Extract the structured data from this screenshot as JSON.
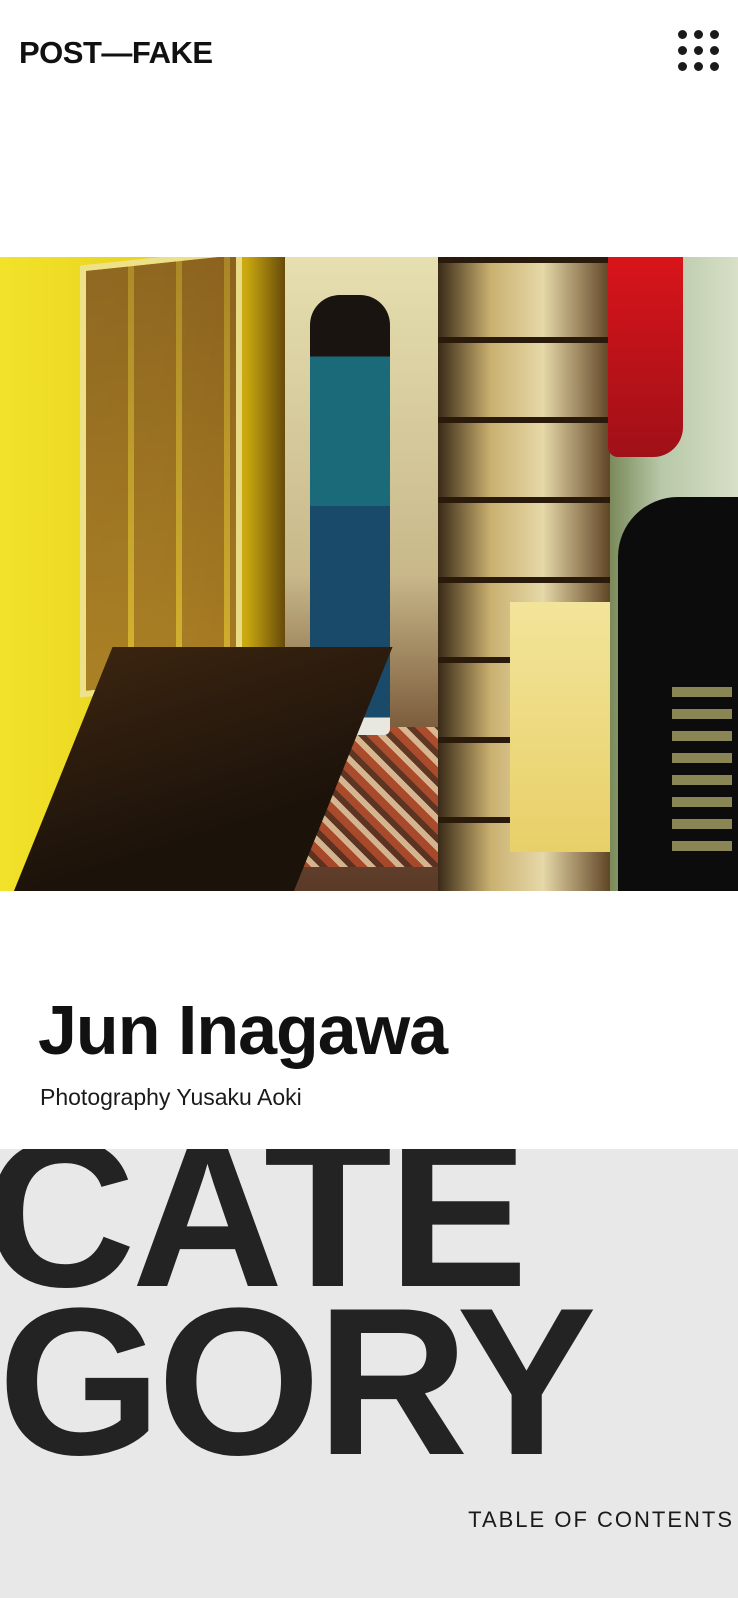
{
  "header": {
    "logo": "POST—FAKE",
    "menu_icon": "grid-menu-icon"
  },
  "article": {
    "hero_image": "hero-photo",
    "title": "Jun Inagawa",
    "credit": "Photography Yusaku Aoki"
  },
  "category": {
    "line1": "CATE",
    "line2": "GORY",
    "toc_label": "TABLE OF CONTENTS"
  }
}
